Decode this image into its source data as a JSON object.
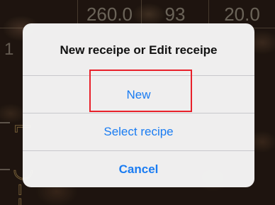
{
  "background": {
    "header_values": [
      "",
      "260.0",
      "93",
      "20.0"
    ],
    "left_digit": "1"
  },
  "alert": {
    "title": "New receipe or Edit receipe",
    "buttons": {
      "new": "New",
      "select": "Select recipe",
      "cancel": "Cancel"
    }
  },
  "colors": {
    "button_text": "#1a7cf2",
    "highlight": "#e8202a"
  }
}
